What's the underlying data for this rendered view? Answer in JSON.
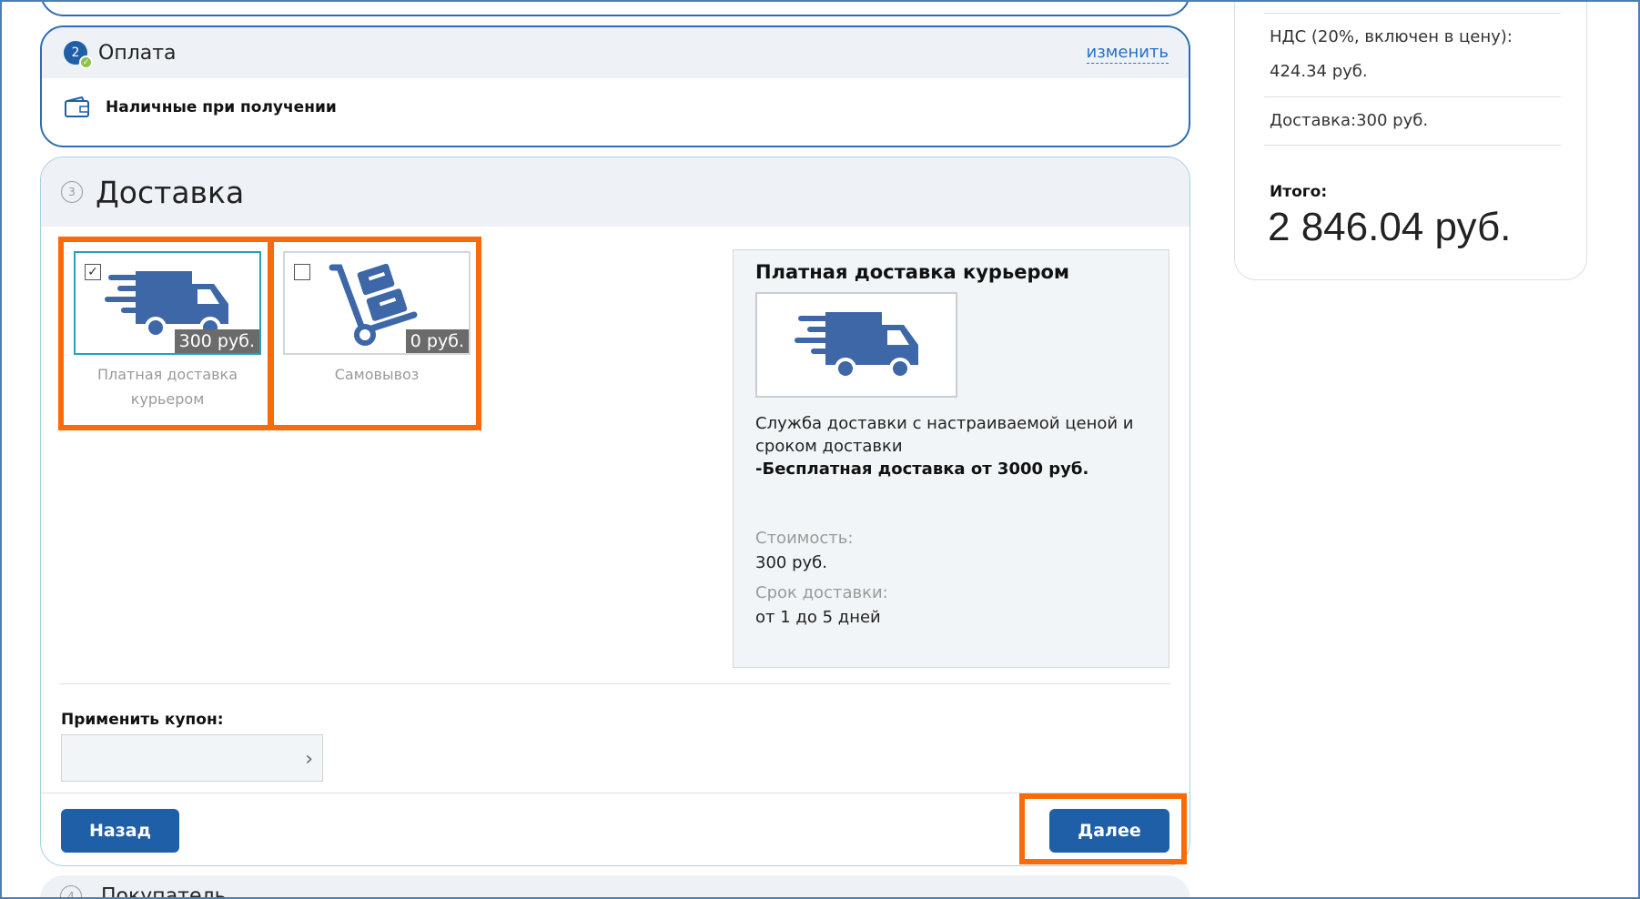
{
  "payment": {
    "step_number": "2",
    "title": "Оплата",
    "change_label": "изменить",
    "method": "Наличные при получении"
  },
  "delivery": {
    "step_number": "3",
    "title": "Доставка",
    "options": [
      {
        "label": "Платная доставка курьером",
        "price": "300 руб.",
        "checked": true,
        "icon": "truck-icon"
      },
      {
        "label": "Самовывоз",
        "price": "0 руб.",
        "checked": false,
        "icon": "hand-truck-icon"
      }
    ],
    "details": {
      "title": "Платная доставка курьером",
      "description": "Служба доставки с настраиваемой ценой и сроком доставки",
      "note": "-Бесплатная доставка от 3000 руб.",
      "cost_label": "Стоимость:",
      "cost_value": "300 руб.",
      "term_label": "Срок доставки:",
      "term_value": "от 1 до 5 дней"
    },
    "coupon_label": "Применить купон:",
    "coupon_value": "",
    "back_label": "Назад",
    "next_label": "Далее"
  },
  "next_section": {
    "step_number": "4",
    "title": "Покупатель"
  },
  "summary": {
    "vat_label": "НДС (20%, включен в цену):",
    "vat_value": "424.34 руб.",
    "delivery_text": "Доставка:300 руб.",
    "total_label": "Итого:",
    "total_value": "2 846.04 руб."
  },
  "colors": {
    "accent": "#1f5fa8",
    "highlight": "#f86a0a",
    "selected_border": "#25a0c4"
  }
}
